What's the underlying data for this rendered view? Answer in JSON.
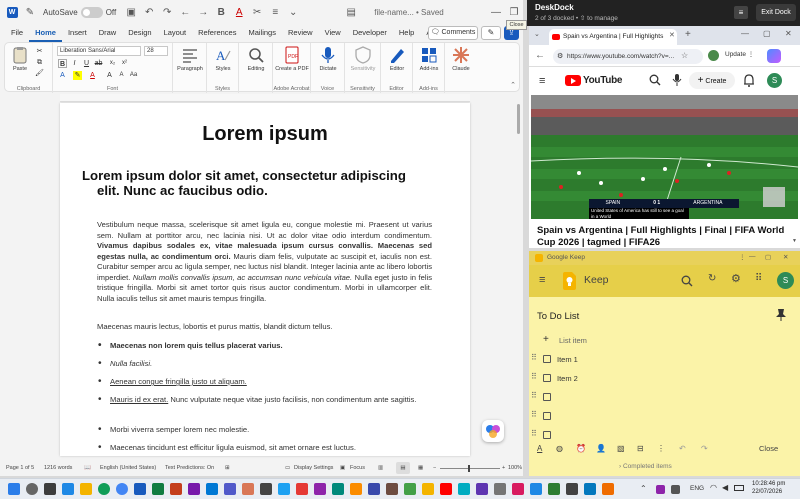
{
  "word": {
    "qat": {
      "autosave_label": "AutoSave",
      "autosave_state": "Off",
      "filename": "file-name... • Saved"
    },
    "menu_tabs": [
      "File",
      "Home",
      "Insert",
      "Draw",
      "Design",
      "Layout",
      "References",
      "Mailings",
      "Review",
      "View",
      "Developer",
      "Help",
      "Acrobat"
    ],
    "active_tab": "Home",
    "comments_label": "Comments",
    "ribbon": {
      "paste_label": "Paste",
      "clipboard_label": "Clipboard",
      "font_name": "Liberation Sans/Arial",
      "font_size": "28",
      "font_label": "Font",
      "paragraph_label": "Paragraph",
      "styles_label": "Styles",
      "editing_label": "Editing",
      "create_pdf_label": "Create a PDF",
      "adobe_label": "Adobe Acrobat",
      "dictate_label": "Dictate",
      "voice_label": "Voice",
      "sensitivity_label": "Sensitivity",
      "editor_label": "Editor",
      "addins_label": "Add-ins",
      "claude_label": "Claude"
    },
    "document": {
      "title": "Lorem ipsum",
      "heading": "Lorem ipsum dolor sit amet, consectetur adipiscing elit. Nunc ac faucibus odio.",
      "para1_a": "Vestibulum neque massa, scelerisque sit amet ligula eu, congue molestie mi. Praesent ut varius sem. Nullam at porttitor arcu, nec lacinia nisi. Ut ac dolor vitae odio interdum condimentum.",
      "para1_bold": "Vivamus dapibus sodales ex, vitae malesuada ipsum cursus convallis. Maecenas sed egestas nulla, ac condimentum orci.",
      "para1_b": "Mauris diam felis, vulputate ac suscipit et, iaculis non est. Curabitur semper arcu ac ligula semper, nec luctus nisl blandit. Integer lacinia ante ac libero lobortis imperdiet.",
      "para1_italic": "Nullam mollis convallis ipsum, ac accumsan nunc vehicula vitae.",
      "para1_c": "Nulla eget justo in felis tristique fringilla. Morbi sit amet tortor quis risus auctor condimentum. Morbi in ullamcorper elit. Nulla iaculis tellus sit amet mauris tempus fringilla.",
      "para2": "Maecenas mauris lectus, lobortis et purus mattis, blandit dictum tellus.",
      "bullets": [
        "Maecenas non lorem quis tellus placerat varius.",
        "Nulla facilisi.",
        "Aenean congue fringilla justo ut aliquam.",
        "Mauris id ex erat.",
        "Morbi viverra semper lorem nec molestie.",
        "Maecenas tincidunt est efficitur ligula euismod, sit amet ornare est luctus."
      ],
      "bullet4_rest": "Nunc vulputate neque vitae justo facilisis, non condimentum ante sagittis."
    },
    "status": {
      "page": "Page 1 of 5",
      "words": "1216 words",
      "language": "English (United States)",
      "text_predictions": "Text Predictions: On",
      "display_settings": "Display Settings",
      "focus": "Focus",
      "zoom": "100%"
    }
  },
  "deskdock": {
    "title": "DeskDock",
    "subtitle": "2 of 3 docked • ⇧ to manage",
    "exit_label": "Exit Dock",
    "close_tooltip": "Close"
  },
  "chrome": {
    "tab_title": "Spain vs Argentina | Full Highlights",
    "url": "https://www.youtube.com/watch?v=...",
    "update_label": "Update",
    "youtube": {
      "logo": "YouTube",
      "create_label": "Create",
      "avatar_letter": "S",
      "video_title": "Spain vs Argentina | Full Highlights | Final | FIFA World Cup 2026 | tagmed | FIFA26",
      "score_left": "SPAIN",
      "score_value": "0 1",
      "score_right": "ARGENTINA",
      "caption": "United States of America has still to see a goal in a World"
    }
  },
  "keep": {
    "window_title": "Google Keep",
    "app_name": "Keep",
    "avatar_letter": "S",
    "note_title": "To Do List",
    "list_item_placeholder": "List item",
    "items": [
      "Item 1",
      "Item 2",
      "",
      "",
      ""
    ],
    "close_label": "Close",
    "completed_label": "Completed items"
  },
  "taskbar": {
    "language": "ENG",
    "time": "10:28:46 pm",
    "date": "22/07/2026"
  },
  "colors": {
    "word_blue": "#185abd",
    "keep_yellow": "#fbf3a8",
    "youtube_red": "#ff0000",
    "deskdock_bg": "#222222"
  }
}
